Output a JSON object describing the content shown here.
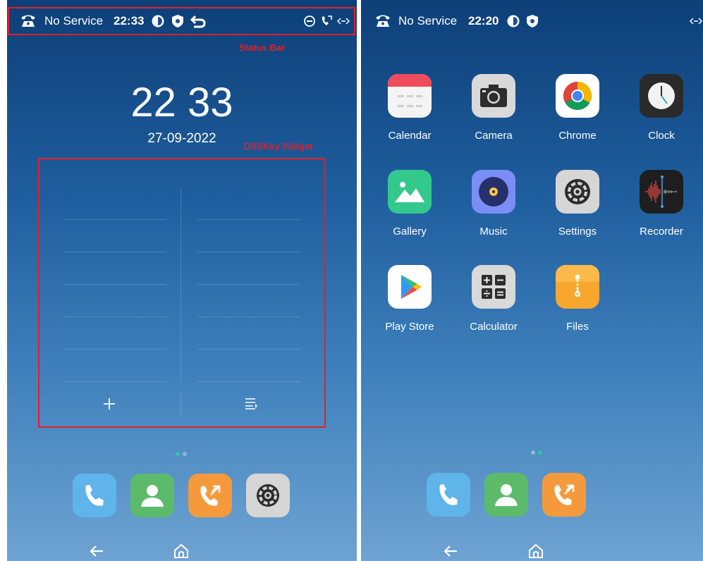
{
  "left_screen": {
    "status": {
      "network": "No Service",
      "time": "22:33",
      "icons": [
        "phone-handset-icon",
        "data-saver-icon",
        "shield-icon",
        "back-arrow-icon",
        "do-not-disturb-icon",
        "call-forward-icon",
        "data-transfer-icon"
      ]
    },
    "annotations": {
      "status_bar": "Status Bar",
      "dsskey_widget": "DSSKey Widget"
    },
    "clock": "22 33",
    "date": "27-09-2022",
    "widget_buttons": [
      "plus-icon",
      "list-menu-icon"
    ],
    "page_indicator": {
      "pages": 2,
      "active": 1
    },
    "dock": [
      "phone-icon",
      "contacts-icon",
      "call-history-icon",
      "settings-icon"
    ],
    "nav": [
      "back-arrow-icon",
      "home-icon"
    ]
  },
  "right_screen": {
    "status": {
      "network": "No Service",
      "time": "22:20",
      "icons": [
        "phone-handset-icon",
        "data-saver-icon",
        "shield-icon",
        "data-transfer-icon"
      ]
    },
    "apps": [
      {
        "label": "Calendar",
        "icon": "calendar-icon"
      },
      {
        "label": "Camera",
        "icon": "camera-icon"
      },
      {
        "label": "Chrome",
        "icon": "chrome-icon"
      },
      {
        "label": "Clock",
        "icon": "clock-icon"
      },
      {
        "label": "Gallery",
        "icon": "gallery-icon"
      },
      {
        "label": "Music",
        "icon": "music-icon"
      },
      {
        "label": "Settings",
        "icon": "settings-icon"
      },
      {
        "label": "Recorder",
        "icon": "recorder-icon"
      },
      {
        "label": "Play Store",
        "icon": "play-store-icon"
      },
      {
        "label": "Calculator",
        "icon": "calculator-icon"
      },
      {
        "label": "Files",
        "icon": "files-icon"
      }
    ],
    "page_indicator": {
      "pages": 2,
      "active": 2
    },
    "dock": [
      "phone-icon",
      "contacts-icon",
      "call-history-icon"
    ],
    "nav": [
      "back-arrow-icon",
      "home-icon"
    ]
  },
  "colors": {
    "annotation_red": "#e0202a",
    "page_dot_active": "#2ec4a0",
    "phone_blue": "#5fb4ea",
    "contacts_green": "#5cbb6a",
    "calls_orange": "#f59a3c",
    "settings_gray": "#d6d6d6"
  }
}
